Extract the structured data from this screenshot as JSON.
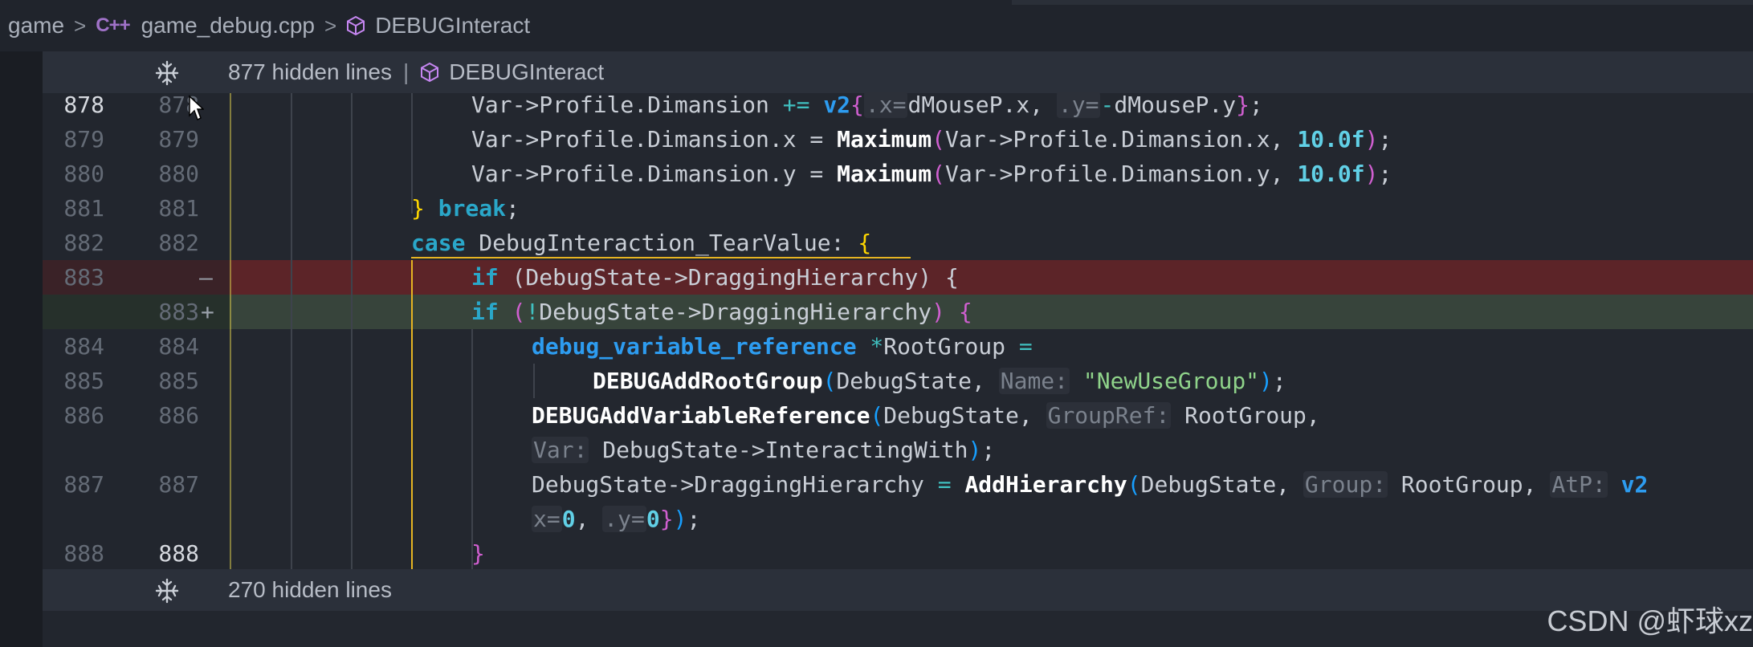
{
  "breadcrumb": {
    "folder": "game",
    "file_icon": "C++",
    "file": "game_debug.cpp",
    "symbol": "DEBUGInteract"
  },
  "fold_top": {
    "text": "877 hidden lines",
    "pipe": "|",
    "symbol": "DEBUGInteract"
  },
  "fold_bottom": {
    "text": "270 hidden lines"
  },
  "line_numbers": {
    "l878": "878",
    "r878": "878",
    "l879": "879",
    "r879": "879",
    "l880": "880",
    "r880": "880",
    "l881": "881",
    "r881": "881",
    "l882": "882",
    "r882": "882",
    "l883": "883",
    "r883": "883",
    "l884": "884",
    "r884": "884",
    "l885": "885",
    "r885": "885",
    "l886": "886",
    "r886": "886",
    "l887": "887",
    "r887": "887",
    "l888": "888",
    "r888": "888",
    "del_mark": "—",
    "ins_mark": "+"
  },
  "code": {
    "l878": {
      "a": "Var->Profile.Dimansion ",
      "op": "+=",
      "ty": "v2",
      "b": "{",
      "h1": ".x=",
      "c": "dMouseP.x, ",
      "h2": ".y=",
      "d": "-",
      "e": "dMouseP.y",
      "f": "}",
      "g": ";"
    },
    "l879": {
      "a": "Var->Profile.Dimansion.x = ",
      "fn": "Maximum",
      "p": "(",
      "b": "Var->Profile.Dimansion.x, ",
      "num": "10.0f",
      "q": ")",
      "c": ";"
    },
    "l880": {
      "a": "Var->Profile.Dimansion.y = ",
      "fn": "Maximum",
      "p": "(",
      "b": "Var->Profile.Dimansion.y, ",
      "num": "10.0f",
      "q": ")",
      "c": ";"
    },
    "l881": {
      "brace": "}",
      "kw": "break",
      "semi": ";"
    },
    "l882": {
      "kw": "case",
      "a": " DebugInteraction_TearValue: ",
      "brace": "{"
    },
    "l883_del": {
      "kw": "if",
      "a": " (DebugState->DraggingHierarchy) {"
    },
    "l883_ins": {
      "kw": "if",
      "p": " (",
      "neg": "!",
      "a": "DebugState->DraggingHierarchy",
      "q": ")",
      "b": " {"
    },
    "l884": {
      "ty": "debug_variable_reference",
      "op": " *",
      "a": "RootGroup ",
      "eq": "="
    },
    "l885": {
      "fn": "DEBUGAddRootGroup",
      "p": "(",
      "a": "DebugState, ",
      "hint": "Name:",
      "str": "\"NewUseGroup\"",
      "q": ")",
      "b": ";"
    },
    "l886": {
      "fn": "DEBUGAddVariableReference",
      "p": "(",
      "a": "DebugState, ",
      "hint": "GroupRef:",
      "b": "RootGroup,"
    },
    "l886b": {
      "hint": "Var:",
      "a": "DebugState->InteractingWith",
      "q": ")",
      "b": ";"
    },
    "l887": {
      "a": "DebugState->DraggingHierarchy ",
      "eq": "=",
      "sp": " ",
      "fn": "AddHierarchy",
      "p": "(",
      "b": "DebugState, ",
      "hint": "Group:",
      "c": "RootGroup, ",
      "hint2": "AtP:",
      "ty": "v2"
    },
    "l887b": {
      "hint": "x=",
      "n1": "0",
      "a": ", ",
      "hint2": ".y=",
      "n2": "0",
      "b": "}",
      "q": ")",
      "c": ";"
    },
    "l888": {
      "brace": "}"
    }
  },
  "watermark": "CSDN @虾球xz",
  "colors": {
    "deleted_line": "#5c2428",
    "inserted_line": "#37443b",
    "keyword": "#2aa7c9",
    "string": "#8fd38a"
  }
}
